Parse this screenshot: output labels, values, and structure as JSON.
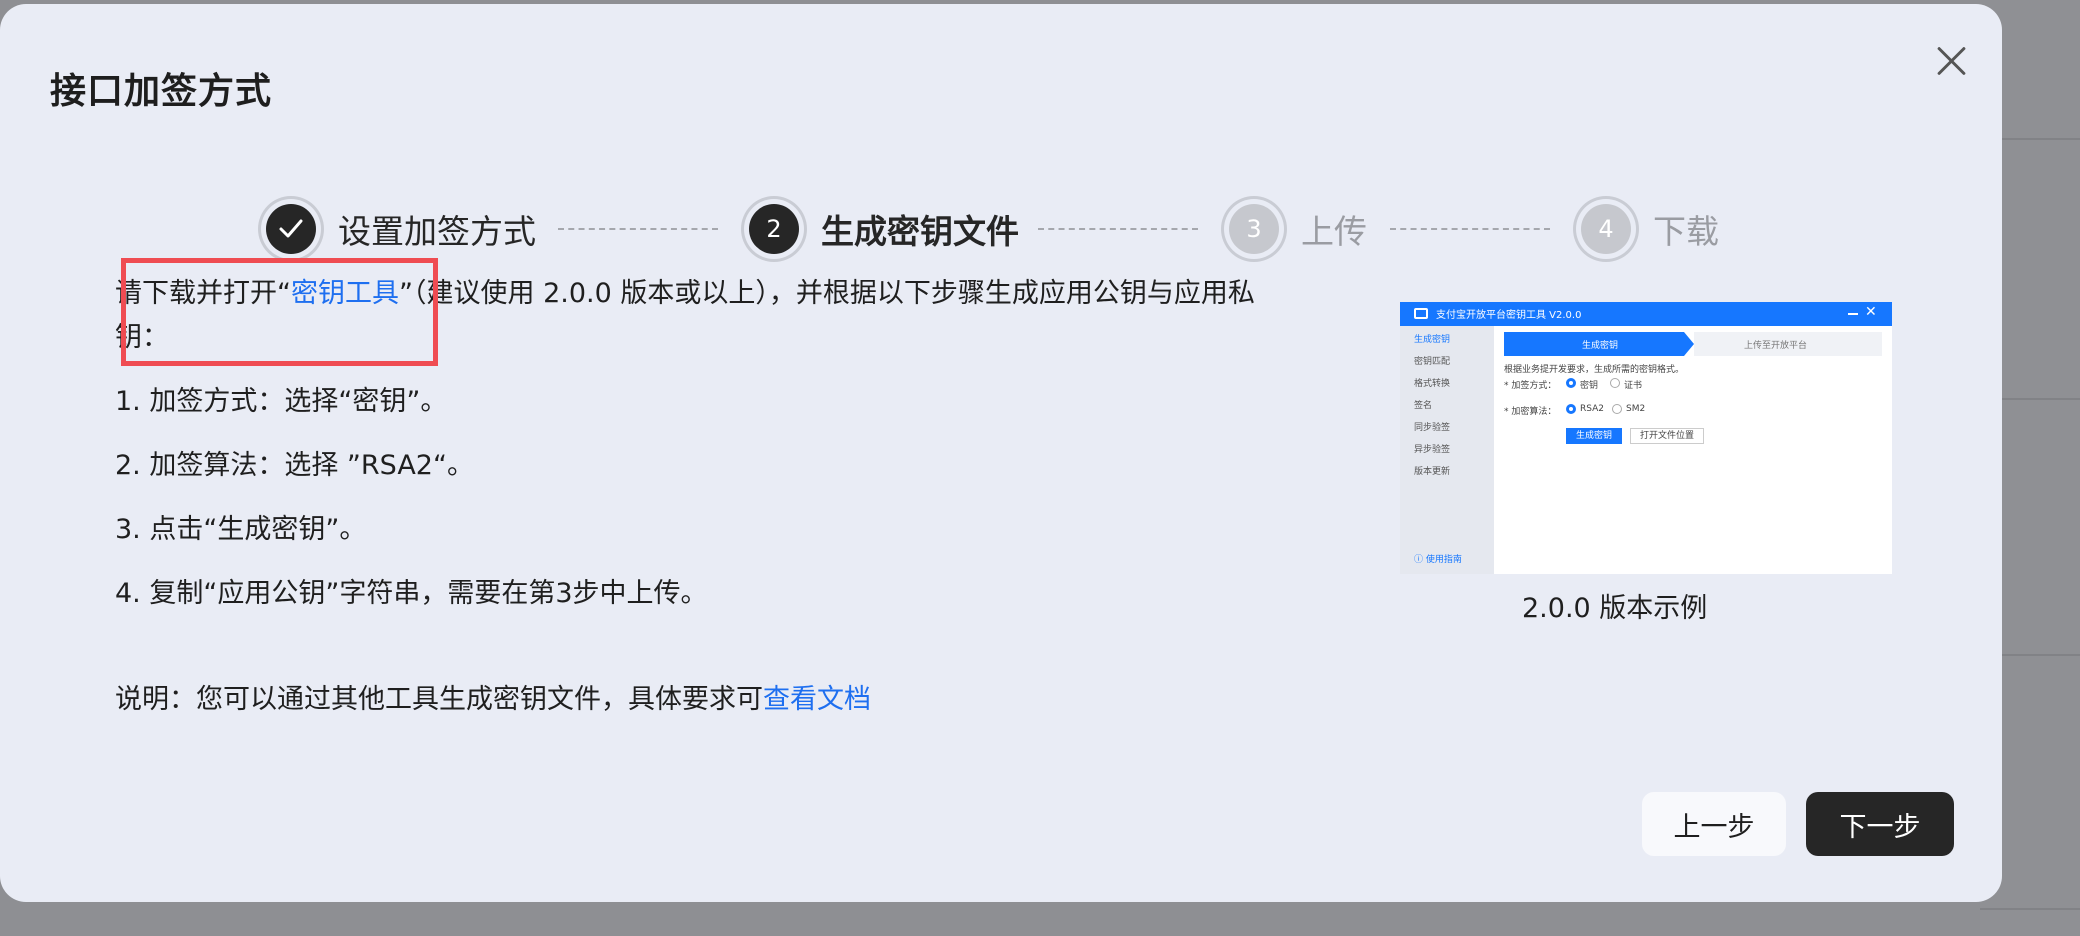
{
  "dialog": {
    "title": "接口加签方式",
    "close_icon": "close-icon"
  },
  "stepper": {
    "steps": [
      {
        "number": "",
        "label": "设置加签方式",
        "state": "done",
        "icon": "checkmark-icon"
      },
      {
        "number": "2",
        "label": "生成密钥文件",
        "state": "active"
      },
      {
        "number": "3",
        "label": "上传",
        "state": "pending"
      },
      {
        "number": "4",
        "label": "下载",
        "state": "pending"
      }
    ]
  },
  "instructions": {
    "intro_prefix": "请下载并打开“",
    "intro_link": "密钥工具",
    "intro_suffix_line1": "”（建议使用 2.0.0 版本或以上），并根据以下步骤生成应用公钥与应用私",
    "intro_suffix_line2": "钥：",
    "items": [
      "1. 加签方式：选择“密钥”。",
      "2. 加签算法：选择 ”RSA2“。",
      "3. 点击“生成密钥”。",
      "4. 复制“应用公钥”字符串，需要在第3步中上传。"
    ],
    "note_prefix": "说明：您可以通过其他工具生成密钥文件，具体要求可",
    "note_link": "查看文档"
  },
  "preview": {
    "window_title": "支付宝开放平台密钥工具 V2.0.0",
    "close_glyph": "✕",
    "sidebar": [
      "生成密钥",
      "密钥匹配",
      "格式转换",
      "签名",
      "同步验签",
      "异步验签",
      "版本更新"
    ],
    "help": "ⓘ 使用指南",
    "tabs": [
      "生成密钥",
      "上传至开放平台"
    ],
    "hint": "根据业务提开发要求，生成所需的密钥格式。",
    "sign_method_label": "* 加签方式：",
    "sign_method_options": [
      "密钥",
      "证书"
    ],
    "algo_label": "* 加密算法：",
    "algo_options": [
      "RSA2",
      "SM2"
    ],
    "generate_button": "生成密钥",
    "open_folder_button": "打开文件位置",
    "caption": "2.0.0 版本示例"
  },
  "footer": {
    "prev_label": "上一步",
    "next_label": "下一步"
  },
  "colors": {
    "link": "#1e6ff0",
    "primary_dark": "#262626",
    "highlight": "#ef4c52",
    "modal_bg": "#e9ecf5"
  }
}
